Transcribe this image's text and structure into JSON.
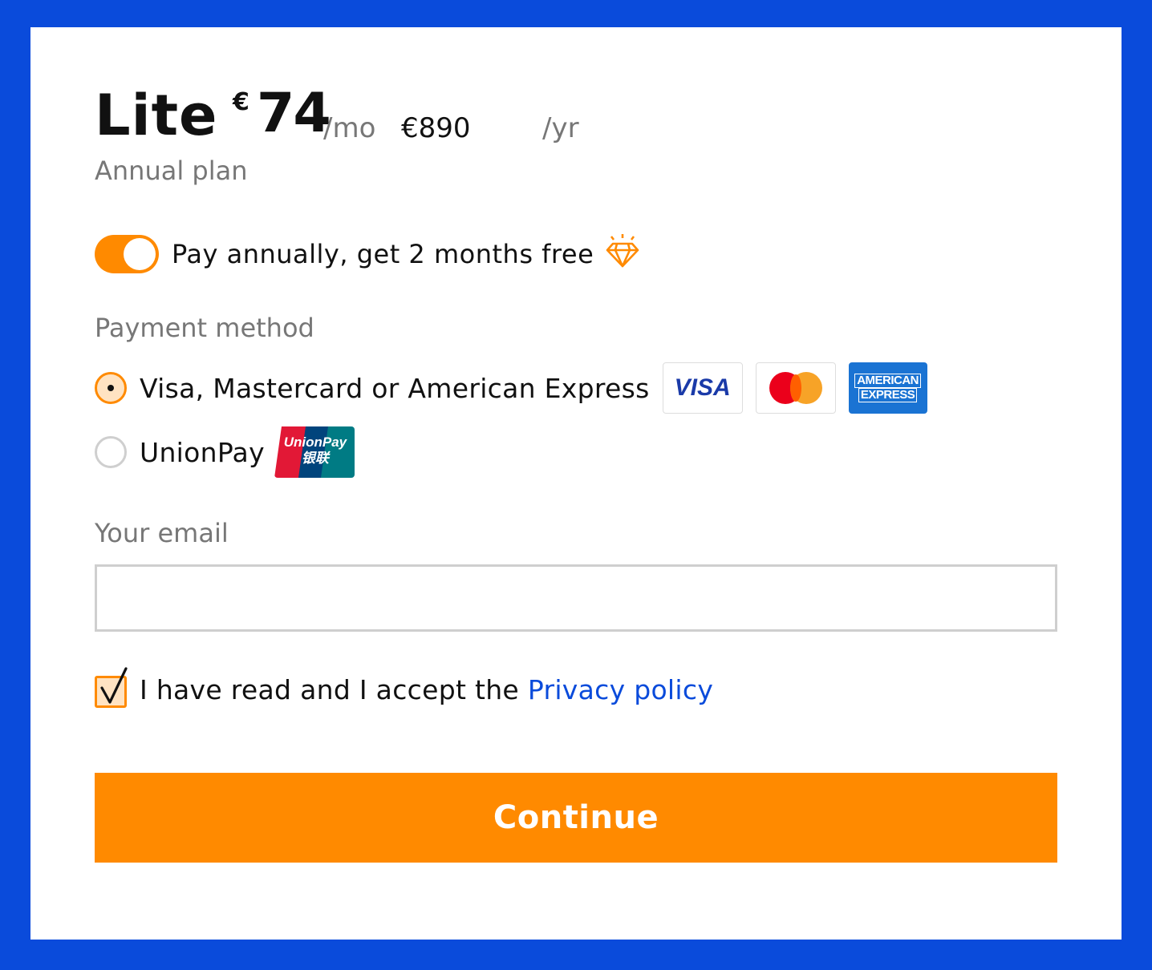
{
  "plan": {
    "name": "Lite",
    "currency_symbol": "€",
    "monthly_price": "74",
    "monthly_unit": "/mo",
    "yearly_price": "€890",
    "yearly_unit": "/yr",
    "subtitle": "Annual plan"
  },
  "billing_toggle": {
    "label": "Pay annually, get 2 months free",
    "on": true,
    "icon": "diamond-icon"
  },
  "payment": {
    "label": "Payment method",
    "options": [
      {
        "label": "Visa, Mastercard or American Express",
        "selected": true,
        "logos": [
          "VISA",
          "mastercard",
          "AMERICAN EXPRESS"
        ]
      },
      {
        "label": "UnionPay",
        "selected": false,
        "logos": [
          "UnionPay 银联"
        ]
      }
    ],
    "logo_text": {
      "visa": "VISA",
      "amex_line1": "AMERICAN",
      "amex_line2": "EXPRESS",
      "unionpay_line1": "UnionPay",
      "unionpay_line2": "银联"
    }
  },
  "email": {
    "label": "Your email",
    "value": "",
    "placeholder": ""
  },
  "consent": {
    "checked": true,
    "text": "I have read and I accept the ",
    "link_text": "Privacy policy"
  },
  "continue_label": "Continue",
  "colors": {
    "frame": "#0a4bdb",
    "accent": "#ff8a00",
    "link": "#0a4bdb"
  }
}
